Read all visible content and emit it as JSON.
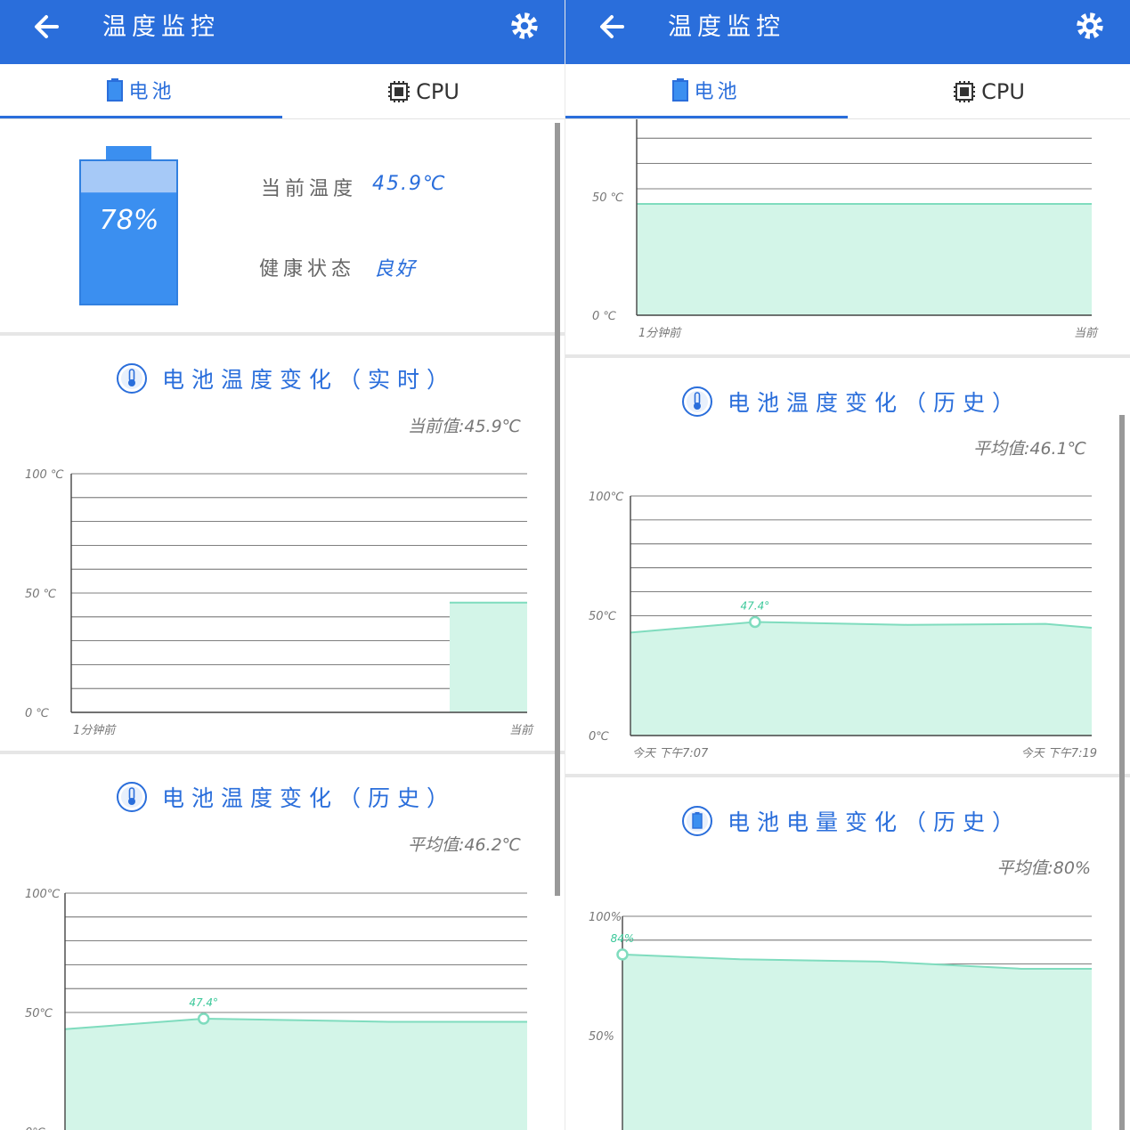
{
  "app": {
    "title": "温度监控",
    "tabs": [
      {
        "label": "电池"
      },
      {
        "label": "CPU"
      }
    ]
  },
  "left": {
    "battery": {
      "percent": "78%",
      "percent_value": 78,
      "current_temp_label": "当前温度",
      "current_temp_value": "45.9℃",
      "health_label": "健康状态",
      "health_value": "良好"
    },
    "realtime": {
      "title": "电池温度变化（实时）",
      "summary": "当前值:45.9℃"
    },
    "history": {
      "title": "电池温度变化（历史）",
      "summary": "平均值:46.2℃"
    }
  },
  "right": {
    "history_temp": {
      "title": "电池温度变化（历史）",
      "summary": "平均值:46.1℃"
    },
    "history_level": {
      "title": "电池电量变化（历史）",
      "summary": "平均值:80%"
    }
  },
  "colors": {
    "accent": "#2a6edb",
    "fill": "#d3f5e8",
    "line": "#7fdcbe",
    "battery": "#3b8ff0",
    "battery_top": "#a6c9f7"
  },
  "chart_data": [
    {
      "id": "left_realtime",
      "type": "area",
      "ylabels": [
        "100 ℃",
        "50 ℃",
        "0 ℃"
      ],
      "xlabels": [
        "1分钟前",
        "当前"
      ],
      "ylim": [
        0,
        100
      ],
      "x": [
        0.83,
        1.0
      ],
      "y": [
        46,
        46
      ]
    },
    {
      "id": "left_history",
      "type": "area",
      "ylabels": [
        "100℃",
        "50℃",
        "0℃"
      ],
      "ylim": [
        0,
        100
      ],
      "x": [
        0,
        0.3,
        0.7,
        1.0
      ],
      "y": [
        43,
        47.4,
        46.1,
        46.1
      ],
      "peak": {
        "x": 0.3,
        "y": 47.4,
        "label": "47.4°"
      }
    },
    {
      "id": "right_realtime_partial",
      "type": "area",
      "ylabels": [
        "50 ℃",
        "0 ℃"
      ],
      "xlabels": [
        "1分钟前",
        "当前"
      ],
      "ylim": [
        0,
        75
      ],
      "x": [
        0,
        1.0
      ],
      "y": [
        44,
        44
      ]
    },
    {
      "id": "right_history_temp",
      "type": "area",
      "ylabels": [
        "100℃",
        "50℃",
        "0℃"
      ],
      "xlabels": [
        "今天 下午7:07",
        "今天 下午7:19"
      ],
      "ylim": [
        0,
        100
      ],
      "x": [
        0,
        0.27,
        0.6,
        0.9,
        1.0
      ],
      "y": [
        43,
        47.4,
        46.2,
        46.6,
        45
      ],
      "peak": {
        "x": 0.27,
        "y": 47.4,
        "label": "47.4°"
      }
    },
    {
      "id": "right_history_level",
      "type": "area",
      "ylabels": [
        "100%",
        "50%"
      ],
      "ylim": [
        0,
        100
      ],
      "x": [
        0,
        0.25,
        0.55,
        0.85,
        1.0
      ],
      "y": [
        84,
        82,
        81,
        78,
        78
      ],
      "peak": {
        "x": 0,
        "y": 84,
        "label": "84%"
      }
    }
  ]
}
